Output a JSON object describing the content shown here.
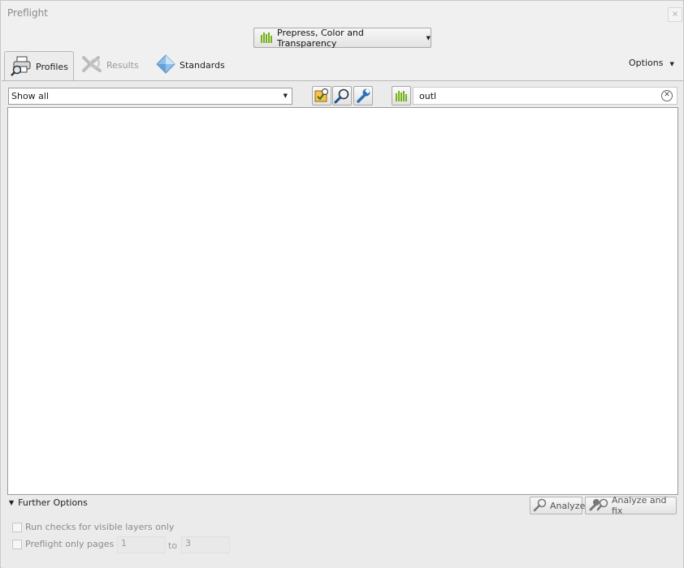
{
  "window": {
    "title": "Preflight",
    "close_label": "×"
  },
  "profile_dropdown": {
    "label": "Prepress, Color and Transparency",
    "icon": "bars-chart-icon"
  },
  "tabs": [
    {
      "label": "Profiles",
      "icon": "profiles-printer-icon",
      "active": true
    },
    {
      "label": "Results",
      "icon": "results-icon",
      "enabled": false
    },
    {
      "label": "Standards",
      "icon": "standards-diamond-icon"
    }
  ],
  "options_label": "Options",
  "toolbar": {
    "filter_value": "Show all",
    "search_value": "outl",
    "buttons": [
      "inspect-icon",
      "magnifier-icon",
      "wrench-icon",
      "bars-chart-icon"
    ]
  },
  "further_options": {
    "label": "Further Options",
    "expanded": true
  },
  "analyze": {
    "analyze_label": "Analyze",
    "analyze_fix_label": "Analyze and fix"
  },
  "options": {
    "visible_layers_label": "Run checks for visible layers only",
    "pages_label": "Preflight only pages",
    "page_from": "1",
    "to_label": "to",
    "page_to": "3"
  },
  "colors": {
    "accent_green": "#74b319",
    "icon_blue": "#2a6fb5"
  }
}
